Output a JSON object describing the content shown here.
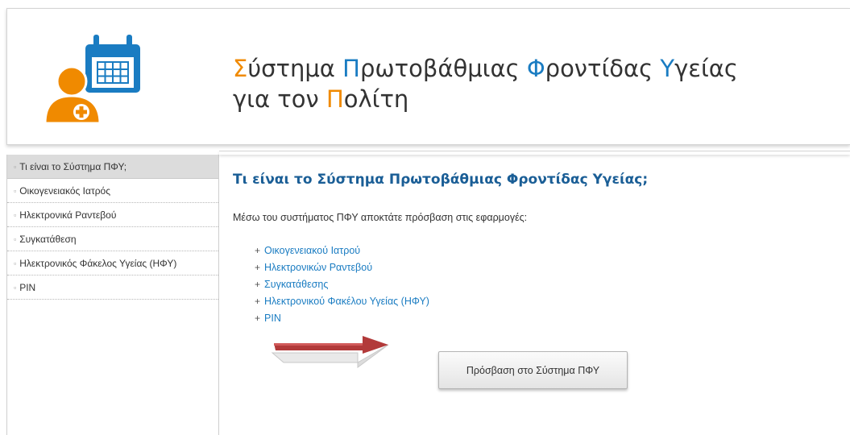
{
  "header": {
    "title_line1": [
      {
        "text": "Σ",
        "accent": "orange"
      },
      {
        "text": "ύστημα ",
        "accent": "none"
      },
      {
        "text": "Π",
        "accent": "blue"
      },
      {
        "text": "ρωτοβάθμιας ",
        "accent": "none"
      },
      {
        "text": "Φ",
        "accent": "blue"
      },
      {
        "text": "ροντίδας ",
        "accent": "none"
      },
      {
        "text": "Υ",
        "accent": "blue"
      },
      {
        "text": "γείας",
        "accent": "none"
      }
    ],
    "title_line2": [
      {
        "text": "για τον ",
        "accent": "none"
      },
      {
        "text": "Π",
        "accent": "orange"
      },
      {
        "text": "ολίτη",
        "accent": "none"
      }
    ],
    "logo_icon": "doctor-calendar-icon"
  },
  "sidebar": {
    "items": [
      {
        "label": "Τι είναι το Σύστημα ΠΦΥ;",
        "active": true
      },
      {
        "label": "Οικογενειακός Ιατρός",
        "active": false
      },
      {
        "label": "Ηλεκτρονικά Ραντεβού",
        "active": false
      },
      {
        "label": "Συγκατάθεση",
        "active": false
      },
      {
        "label": "Ηλεκτρονικός Φάκελος Υγείας (ΗΦΥ)",
        "active": false
      },
      {
        "label": "PIN",
        "active": false
      }
    ],
    "bullet": "▫"
  },
  "main": {
    "heading": "Τι είναι το Σύστημα Πρωτοβάθμιας Φροντίδας Υγείας;",
    "intro": "Μέσω του συστήματος ΠΦΥ αποκτάτε πρόσβαση στις εφαρμογές:",
    "links": [
      "Οικογενειακού Ιατρού",
      "Ηλεκτρονικών Ραντεβού",
      "Συγκατάθεσης",
      "Ηλεκτρονικού Φακέλου Υγείας (ΗΦΥ)",
      "PIN"
    ],
    "link_prefix": "+",
    "access_button_label": "Πρόσβαση στο Σύστημα ΠΦΥ"
  },
  "colors": {
    "orange": "#f08a00",
    "blue": "#1a7cc2",
    "heading_blue": "#1a5e96",
    "arrow_red": "#b23a3a"
  }
}
